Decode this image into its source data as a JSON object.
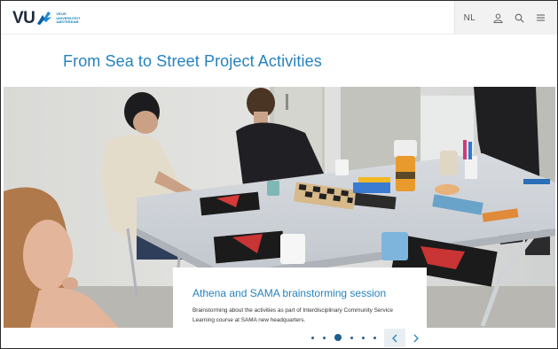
{
  "header": {
    "logo": {
      "mark": "VU",
      "lines": [
        "VRIJE",
        "UNIVERSITEIT",
        "AMSTERDAM"
      ]
    },
    "language": "NL",
    "icons": [
      "user-icon",
      "search-icon",
      "menu-icon"
    ]
  },
  "page": {
    "title": "From Sea to Street Project Activities"
  },
  "carousel": {
    "slide_title": "Athena and SAMA brainstorming session",
    "slide_text": "Brainstorming about the activities as part of Interdisciplinary Community Service Learning course at SAMA new headquarters.",
    "slide_count": 6,
    "active_index": 2
  },
  "colors": {
    "accent": "#2582bf",
    "dark": "#1e2a3a",
    "dot": "#1f5e8f"
  }
}
